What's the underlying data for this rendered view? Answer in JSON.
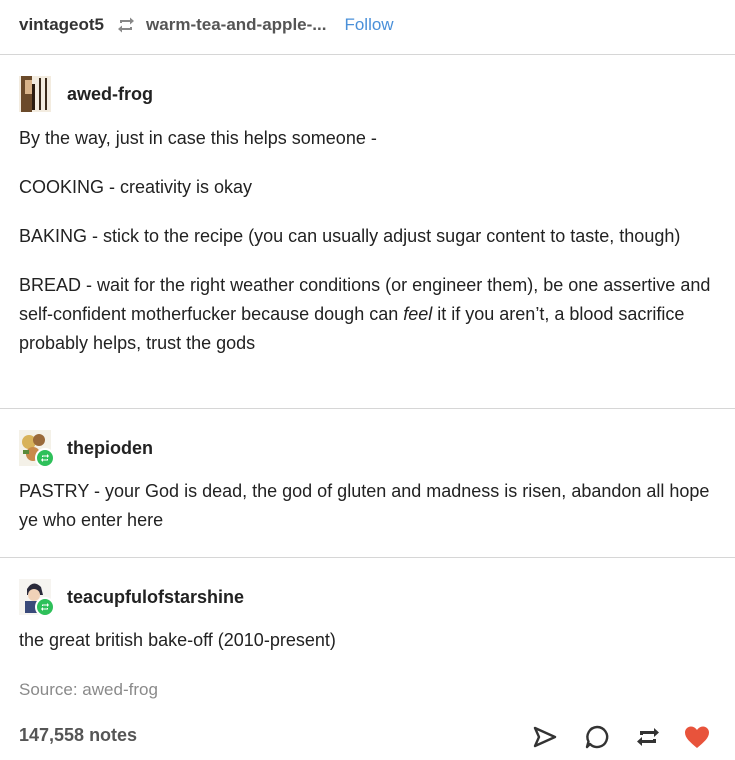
{
  "header": {
    "username": "vintageot5",
    "reblog_source": "warm-tea-and-apple-...",
    "follow_label": "Follow"
  },
  "posts": [
    {
      "author": "awed-frog",
      "paragraphs": [
        "By the way, just in case this helps someone -",
        "COOKING - creativity is okay",
        "BAKING - stick to the recipe (you can usually adjust sugar content to taste, though)"
      ],
      "bread": {
        "before": "BREAD - wait for the right weather conditions (or engineer them), be one assertive and self-confident motherfucker because dough can ",
        "emphasis": "feel",
        "after": " it if you aren’t, a blood sacrifice probably helps, trust the gods"
      }
    },
    {
      "author": "thepioden",
      "paragraphs": [
        "PASTRY - your God is dead, the god of gluten and madness is risen, abandon all hope ye who enter here"
      ]
    },
    {
      "author": "teacupfulofstarshine",
      "paragraphs": [
        "the great british bake-off (2010-present)"
      ]
    }
  ],
  "footer": {
    "source_line": "Source: awed-frog",
    "notes": "147,558 notes"
  },
  "icons": {
    "reblog": "reblog-icon",
    "share": "share-icon",
    "reply": "reply-icon",
    "reblog_action": "reblog-icon",
    "like": "heart-icon"
  },
  "colors": {
    "follow": "#4a90d9",
    "like": "#e8533b",
    "reblog_badge": "#2ec05a"
  }
}
